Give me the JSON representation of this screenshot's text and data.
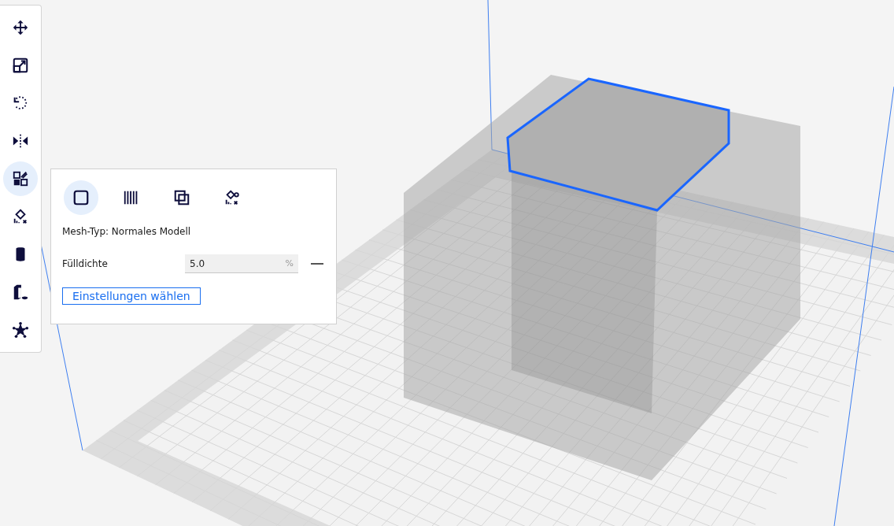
{
  "tools": [
    {
      "kind": "move",
      "selected": false
    },
    {
      "kind": "scale",
      "selected": false
    },
    {
      "kind": "rotate",
      "selected": false
    },
    {
      "kind": "mirror",
      "selected": false
    },
    {
      "kind": "per-model",
      "selected": true
    },
    {
      "kind": "support-blocker",
      "selected": false
    },
    {
      "kind": "cylinder",
      "selected": false
    },
    {
      "kind": "tree",
      "selected": false
    },
    {
      "kind": "star",
      "selected": false
    }
  ],
  "panel": {
    "mesh_types": [
      {
        "kind": "normal",
        "selected": true
      },
      {
        "kind": "infill",
        "selected": false
      },
      {
        "kind": "overlap",
        "selected": false
      },
      {
        "kind": "no-support",
        "selected": false
      }
    ],
    "mesh_type_label": "Mesh-Typ: Normales Modell",
    "setting": {
      "label": "Fülldichte",
      "value": "5.0",
      "unit": "%"
    },
    "button": "Einstellungen wählen"
  }
}
